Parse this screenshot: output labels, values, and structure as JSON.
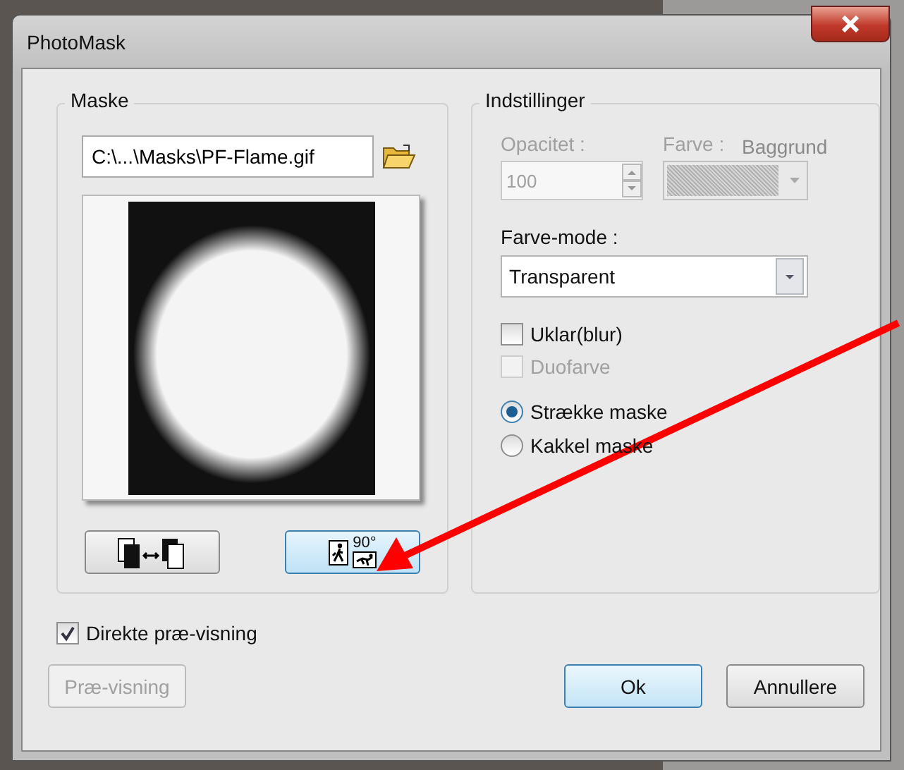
{
  "window": {
    "title": "PhotoMask"
  },
  "background": {
    "label": "Baggrund"
  },
  "mask_group": {
    "title": "Maske",
    "path_value": "C:\\...\\Masks\\PF-Flame.gif",
    "swap_button": {
      "hovered": false
    },
    "rotate_button": {
      "label": "90°",
      "hovered": true
    }
  },
  "settings_group": {
    "title": "Indstillinger",
    "opacity": {
      "label": "Opacitet :",
      "value": "100",
      "disabled": true
    },
    "color": {
      "label": "Farve :",
      "disabled": true
    },
    "color_mode": {
      "label": "Farve-mode :",
      "value": "Transparent"
    },
    "checkboxes": [
      {
        "label": "Uklar(blur)",
        "checked": false,
        "disabled": false
      },
      {
        "label": "Duofarve",
        "checked": false,
        "disabled": true
      }
    ],
    "radios": [
      {
        "label": "Strække maske",
        "selected": true
      },
      {
        "label": "Kakkel maske",
        "selected": false
      }
    ]
  },
  "live_preview": {
    "label": "Direkte præ-visning",
    "checked": true
  },
  "buttons": [
    {
      "kind": "preview",
      "label": "Præ-visning",
      "disabled": true
    },
    {
      "kind": "ok",
      "label": "Ok",
      "disabled": false
    },
    {
      "kind": "cancel",
      "label": "Annullere",
      "disabled": false
    }
  ]
}
